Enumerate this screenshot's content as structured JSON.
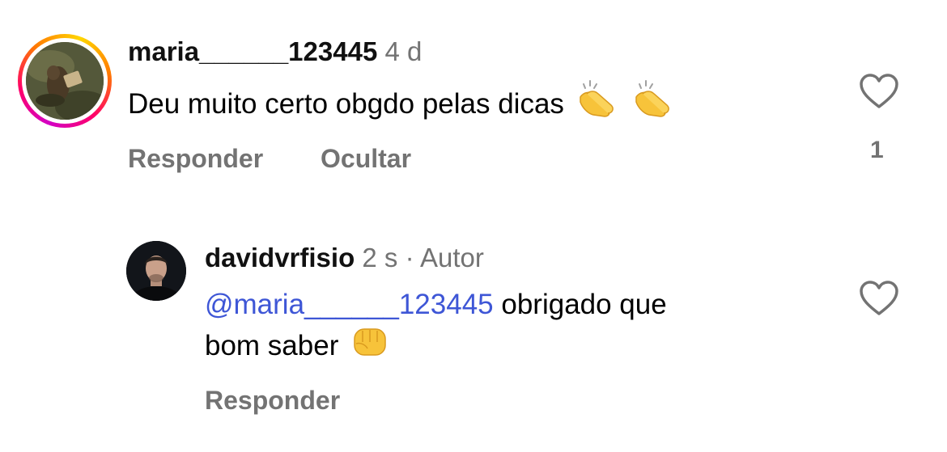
{
  "comment": {
    "username": "maria______123445",
    "time": "4 d",
    "text": "Deu muito certo obgdo pelas dicas",
    "emoji": "clapping-hands-x2",
    "reply_label": "Responder",
    "hide_label": "Ocultar",
    "like_count": "1"
  },
  "reply": {
    "username": "davidvrfisio",
    "time": "2 s",
    "separator": "·",
    "author_badge": "Autor",
    "mention": "@maria______123445",
    "text_line1": " obrigado que",
    "text_line2": "bom saber",
    "emoji": "oncoming-fist",
    "reply_label": "Responder"
  },
  "colors": {
    "mention": "#3e56d6",
    "muted": "#737373",
    "emoji_yellow": "#f7c33a"
  }
}
